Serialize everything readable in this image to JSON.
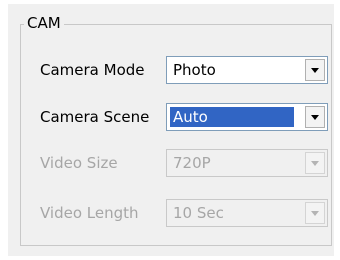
{
  "group": {
    "title": "CAM"
  },
  "rows": [
    {
      "label": "Camera Mode",
      "value": "Photo",
      "enabled": true,
      "selected": false
    },
    {
      "label": "Camera Scene",
      "value": "Auto",
      "enabled": true,
      "selected": true
    },
    {
      "label": "Video Size",
      "value": "720P",
      "enabled": false,
      "selected": false
    },
    {
      "label": "Video Length",
      "value": "10 Sec",
      "enabled": false,
      "selected": false
    }
  ],
  "icons": {
    "dropdown": "chevron-down-icon"
  },
  "colors": {
    "panel_bg": "#f0f0f0",
    "selection": "#3165c4",
    "disabled_text": "#a6a6a6",
    "combo_border": "#7f9db9"
  }
}
